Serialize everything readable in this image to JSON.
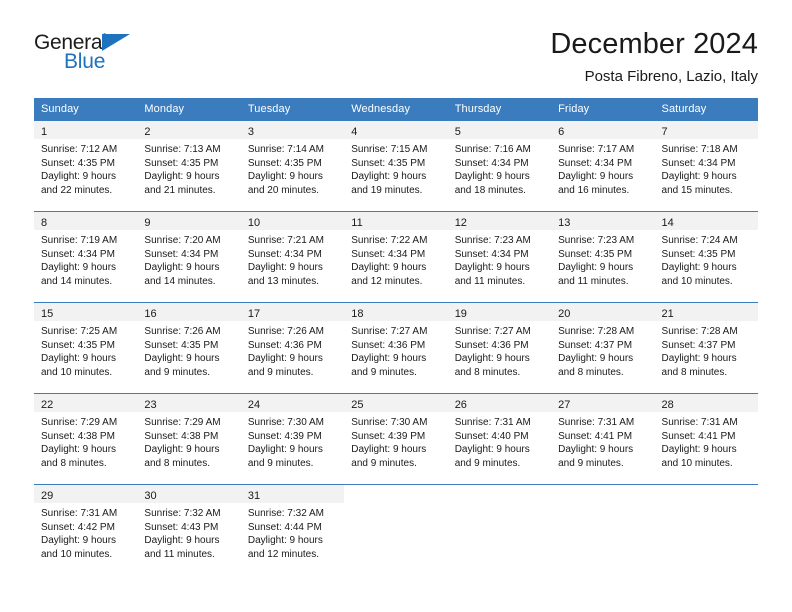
{
  "logo": {
    "word_top": "General",
    "word_bottom": "Blue",
    "accent_color": "#1f72bd",
    "triangle_icon": "triangle-icon"
  },
  "header": {
    "title": "December 2024",
    "subtitle": "Posta Fibreno, Lazio, Italy"
  },
  "calendar": {
    "header_bg": "#3b7cbf",
    "band_bg": "#f2f2f2",
    "weekday_headers": [
      "Sunday",
      "Monday",
      "Tuesday",
      "Wednesday",
      "Thursday",
      "Friday",
      "Saturday"
    ],
    "weeks": [
      [
        {
          "day": "1",
          "sunrise": "Sunrise: 7:12 AM",
          "sunset": "Sunset: 4:35 PM",
          "daylight_line1": "Daylight: 9 hours",
          "daylight_line2": "and 22 minutes."
        },
        {
          "day": "2",
          "sunrise": "Sunrise: 7:13 AM",
          "sunset": "Sunset: 4:35 PM",
          "daylight_line1": "Daylight: 9 hours",
          "daylight_line2": "and 21 minutes."
        },
        {
          "day": "3",
          "sunrise": "Sunrise: 7:14 AM",
          "sunset": "Sunset: 4:35 PM",
          "daylight_line1": "Daylight: 9 hours",
          "daylight_line2": "and 20 minutes."
        },
        {
          "day": "4",
          "sunrise": "Sunrise: 7:15 AM",
          "sunset": "Sunset: 4:35 PM",
          "daylight_line1": "Daylight: 9 hours",
          "daylight_line2": "and 19 minutes."
        },
        {
          "day": "5",
          "sunrise": "Sunrise: 7:16 AM",
          "sunset": "Sunset: 4:34 PM",
          "daylight_line1": "Daylight: 9 hours",
          "daylight_line2": "and 18 minutes."
        },
        {
          "day": "6",
          "sunrise": "Sunrise: 7:17 AM",
          "sunset": "Sunset: 4:34 PM",
          "daylight_line1": "Daylight: 9 hours",
          "daylight_line2": "and 16 minutes."
        },
        {
          "day": "7",
          "sunrise": "Sunrise: 7:18 AM",
          "sunset": "Sunset: 4:34 PM",
          "daylight_line1": "Daylight: 9 hours",
          "daylight_line2": "and 15 minutes."
        }
      ],
      [
        {
          "day": "8",
          "sunrise": "Sunrise: 7:19 AM",
          "sunset": "Sunset: 4:34 PM",
          "daylight_line1": "Daylight: 9 hours",
          "daylight_line2": "and 14 minutes."
        },
        {
          "day": "9",
          "sunrise": "Sunrise: 7:20 AM",
          "sunset": "Sunset: 4:34 PM",
          "daylight_line1": "Daylight: 9 hours",
          "daylight_line2": "and 14 minutes."
        },
        {
          "day": "10",
          "sunrise": "Sunrise: 7:21 AM",
          "sunset": "Sunset: 4:34 PM",
          "daylight_line1": "Daylight: 9 hours",
          "daylight_line2": "and 13 minutes."
        },
        {
          "day": "11",
          "sunrise": "Sunrise: 7:22 AM",
          "sunset": "Sunset: 4:34 PM",
          "daylight_line1": "Daylight: 9 hours",
          "daylight_line2": "and 12 minutes."
        },
        {
          "day": "12",
          "sunrise": "Sunrise: 7:23 AM",
          "sunset": "Sunset: 4:34 PM",
          "daylight_line1": "Daylight: 9 hours",
          "daylight_line2": "and 11 minutes."
        },
        {
          "day": "13",
          "sunrise": "Sunrise: 7:23 AM",
          "sunset": "Sunset: 4:35 PM",
          "daylight_line1": "Daylight: 9 hours",
          "daylight_line2": "and 11 minutes."
        },
        {
          "day": "14",
          "sunrise": "Sunrise: 7:24 AM",
          "sunset": "Sunset: 4:35 PM",
          "daylight_line1": "Daylight: 9 hours",
          "daylight_line2": "and 10 minutes."
        }
      ],
      [
        {
          "day": "15",
          "sunrise": "Sunrise: 7:25 AM",
          "sunset": "Sunset: 4:35 PM",
          "daylight_line1": "Daylight: 9 hours",
          "daylight_line2": "and 10 minutes."
        },
        {
          "day": "16",
          "sunrise": "Sunrise: 7:26 AM",
          "sunset": "Sunset: 4:35 PM",
          "daylight_line1": "Daylight: 9 hours",
          "daylight_line2": "and 9 minutes."
        },
        {
          "day": "17",
          "sunrise": "Sunrise: 7:26 AM",
          "sunset": "Sunset: 4:36 PM",
          "daylight_line1": "Daylight: 9 hours",
          "daylight_line2": "and 9 minutes."
        },
        {
          "day": "18",
          "sunrise": "Sunrise: 7:27 AM",
          "sunset": "Sunset: 4:36 PM",
          "daylight_line1": "Daylight: 9 hours",
          "daylight_line2": "and 9 minutes."
        },
        {
          "day": "19",
          "sunrise": "Sunrise: 7:27 AM",
          "sunset": "Sunset: 4:36 PM",
          "daylight_line1": "Daylight: 9 hours",
          "daylight_line2": "and 8 minutes."
        },
        {
          "day": "20",
          "sunrise": "Sunrise: 7:28 AM",
          "sunset": "Sunset: 4:37 PM",
          "daylight_line1": "Daylight: 9 hours",
          "daylight_line2": "and 8 minutes."
        },
        {
          "day": "21",
          "sunrise": "Sunrise: 7:28 AM",
          "sunset": "Sunset: 4:37 PM",
          "daylight_line1": "Daylight: 9 hours",
          "daylight_line2": "and 8 minutes."
        }
      ],
      [
        {
          "day": "22",
          "sunrise": "Sunrise: 7:29 AM",
          "sunset": "Sunset: 4:38 PM",
          "daylight_line1": "Daylight: 9 hours",
          "daylight_line2": "and 8 minutes."
        },
        {
          "day": "23",
          "sunrise": "Sunrise: 7:29 AM",
          "sunset": "Sunset: 4:38 PM",
          "daylight_line1": "Daylight: 9 hours",
          "daylight_line2": "and 8 minutes."
        },
        {
          "day": "24",
          "sunrise": "Sunrise: 7:30 AM",
          "sunset": "Sunset: 4:39 PM",
          "daylight_line1": "Daylight: 9 hours",
          "daylight_line2": "and 9 minutes."
        },
        {
          "day": "25",
          "sunrise": "Sunrise: 7:30 AM",
          "sunset": "Sunset: 4:39 PM",
          "daylight_line1": "Daylight: 9 hours",
          "daylight_line2": "and 9 minutes."
        },
        {
          "day": "26",
          "sunrise": "Sunrise: 7:31 AM",
          "sunset": "Sunset: 4:40 PM",
          "daylight_line1": "Daylight: 9 hours",
          "daylight_line2": "and 9 minutes."
        },
        {
          "day": "27",
          "sunrise": "Sunrise: 7:31 AM",
          "sunset": "Sunset: 4:41 PM",
          "daylight_line1": "Daylight: 9 hours",
          "daylight_line2": "and 9 minutes."
        },
        {
          "day": "28",
          "sunrise": "Sunrise: 7:31 AM",
          "sunset": "Sunset: 4:41 PM",
          "daylight_line1": "Daylight: 9 hours",
          "daylight_line2": "and 10 minutes."
        }
      ],
      [
        {
          "day": "29",
          "sunrise": "Sunrise: 7:31 AM",
          "sunset": "Sunset: 4:42 PM",
          "daylight_line1": "Daylight: 9 hours",
          "daylight_line2": "and 10 minutes."
        },
        {
          "day": "30",
          "sunrise": "Sunrise: 7:32 AM",
          "sunset": "Sunset: 4:43 PM",
          "daylight_line1": "Daylight: 9 hours",
          "daylight_line2": "and 11 minutes."
        },
        {
          "day": "31",
          "sunrise": "Sunrise: 7:32 AM",
          "sunset": "Sunset: 4:44 PM",
          "daylight_line1": "Daylight: 9 hours",
          "daylight_line2": "and 12 minutes."
        },
        null,
        null,
        null,
        null
      ]
    ]
  }
}
